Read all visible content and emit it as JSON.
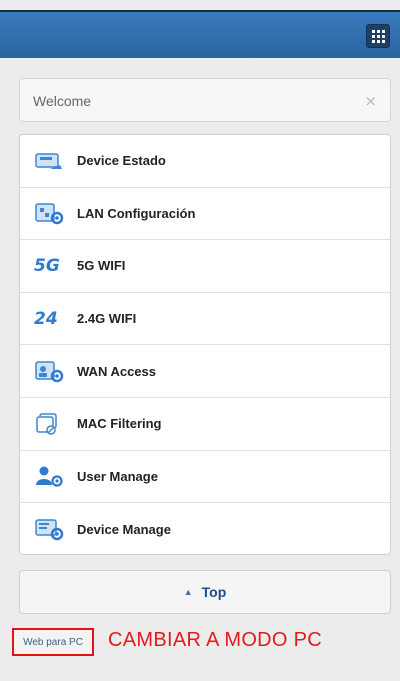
{
  "header": {
    "menu_icon": "grid-menu-icon",
    "background": "#2f6aa8"
  },
  "welcome": {
    "text": "Welcome",
    "close_icon": "close-icon",
    "close_glyph": "×"
  },
  "menu": {
    "items": [
      {
        "label": "Device Estado",
        "icon": "device-status-icon"
      },
      {
        "label": "LAN Configuración",
        "icon": "lan-config-icon"
      },
      {
        "label": "5G WIFI",
        "icon": "wifi-5g-icon",
        "icon_text": "5G"
      },
      {
        "label": "2.4G WIFI",
        "icon": "wifi-24g-icon",
        "icon_text": "24"
      },
      {
        "label": "WAN Access",
        "icon": "wan-access-icon"
      },
      {
        "label": "MAC Filtering",
        "icon": "mac-filter-icon"
      },
      {
        "label": "User Manage",
        "icon": "user-manage-icon"
      },
      {
        "label": "Device Manage",
        "icon": "device-manage-icon"
      }
    ]
  },
  "top_button": {
    "label": "Top",
    "arrow": "▲"
  },
  "footer": {
    "web_pc_link": "Web para PC",
    "annotation": "CAMBIAR A MODO PC",
    "annotation_color": "#e21b1b"
  }
}
